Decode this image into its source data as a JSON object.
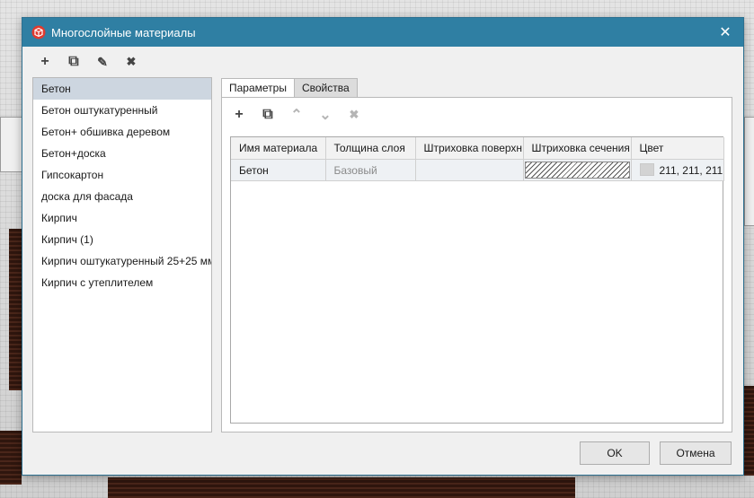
{
  "window": {
    "title": "Многослойные материалы",
    "icon": "app-cube-icon",
    "close_glyph": "✕"
  },
  "toolbar": {
    "add_glyph": "+",
    "copy_glyph": "⧉",
    "edit_glyph": "✎",
    "delete_glyph": "✖"
  },
  "materials": [
    {
      "label": "Бетон",
      "selected": true
    },
    {
      "label": "Бетон оштукатуренный"
    },
    {
      "label": "Бетон+ обшивка деревом"
    },
    {
      "label": "Бетон+доска"
    },
    {
      "label": "Гипсокартон"
    },
    {
      "label": "доска для фасада"
    },
    {
      "label": "Кирпич"
    },
    {
      "label": "Кирпич (1)"
    },
    {
      "label": "Кирпич оштукатуренный 25+25 мм"
    },
    {
      "label": "Кирпич с утеплителем"
    }
  ],
  "tabs": [
    {
      "label": "Параметры",
      "active": true
    },
    {
      "label": "Свойства"
    }
  ],
  "layer_toolbar": {
    "add_glyph": "+",
    "copy_glyph": "⧉",
    "up_glyph": "⌃",
    "down_glyph": "⌄",
    "delete_glyph": "✖"
  },
  "layers_table": {
    "columns": [
      "Имя материала",
      "Толщина слоя",
      "Штриховка поверхн",
      "Штриховка сечения",
      "Цвет"
    ],
    "rows": [
      {
        "material": "Бетон",
        "thickness": "Базовый",
        "surface_hatch": "",
        "section_hatch": "diagonal-hatch",
        "color": "211, 211, 211",
        "color_hex": "#d3d3d3"
      }
    ]
  },
  "buttons": {
    "ok": "OK",
    "cancel": "Отмена"
  },
  "colors": {
    "titlebar": "#2f7fa3",
    "selection": "#cdd6e0"
  }
}
